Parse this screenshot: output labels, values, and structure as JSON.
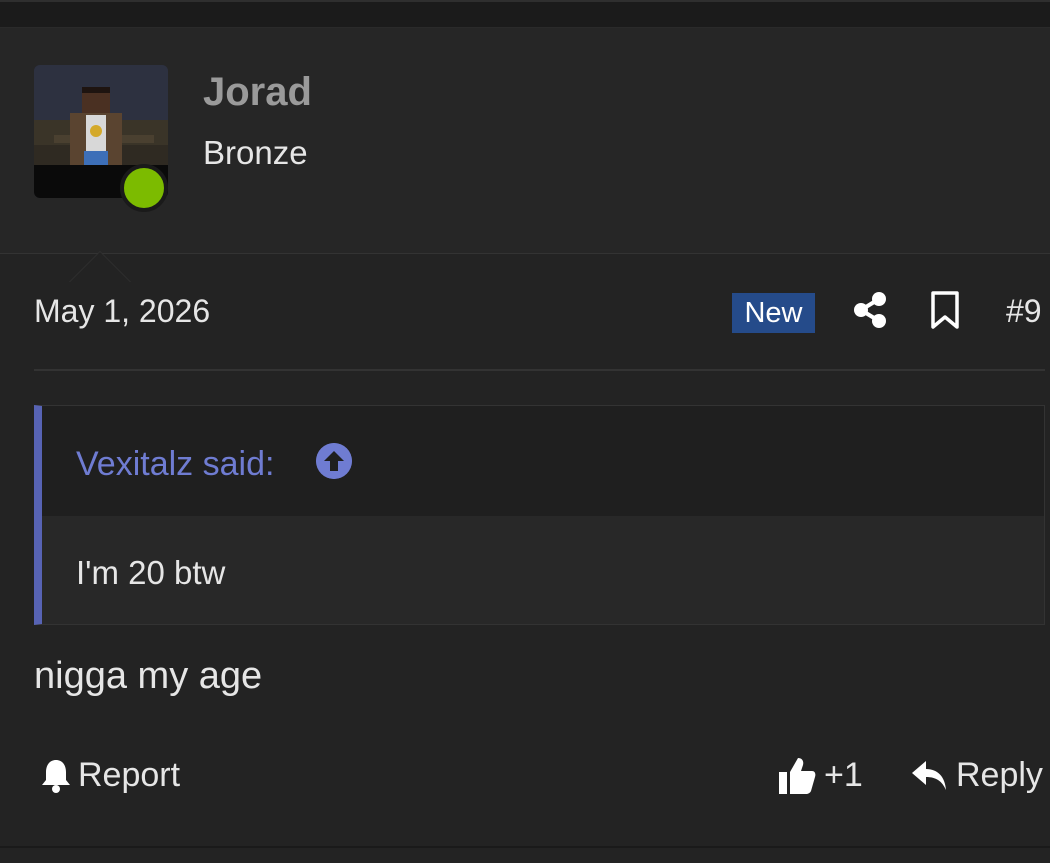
{
  "post": {
    "username": "Jorad",
    "user_title": "Bronze",
    "date": "May 1, 2026",
    "badge": "New",
    "post_number": "#9",
    "message": "nigga my age"
  },
  "quote": {
    "author": "Vexitalz said:",
    "text": "I'm 20 btw"
  },
  "actions": {
    "report": "Report",
    "like": "+1",
    "reply": "Reply"
  },
  "icons": [
    "share-icon",
    "bookmark-icon",
    "arrow-up-circle-icon",
    "bell-icon",
    "thumbs-up-icon",
    "reply-icon"
  ],
  "colors": {
    "background": "#232323",
    "online": "#7cbb00",
    "badge": "#254b8a",
    "quote_accent": "#5763b4",
    "quote_author": "#6f7cd2"
  }
}
